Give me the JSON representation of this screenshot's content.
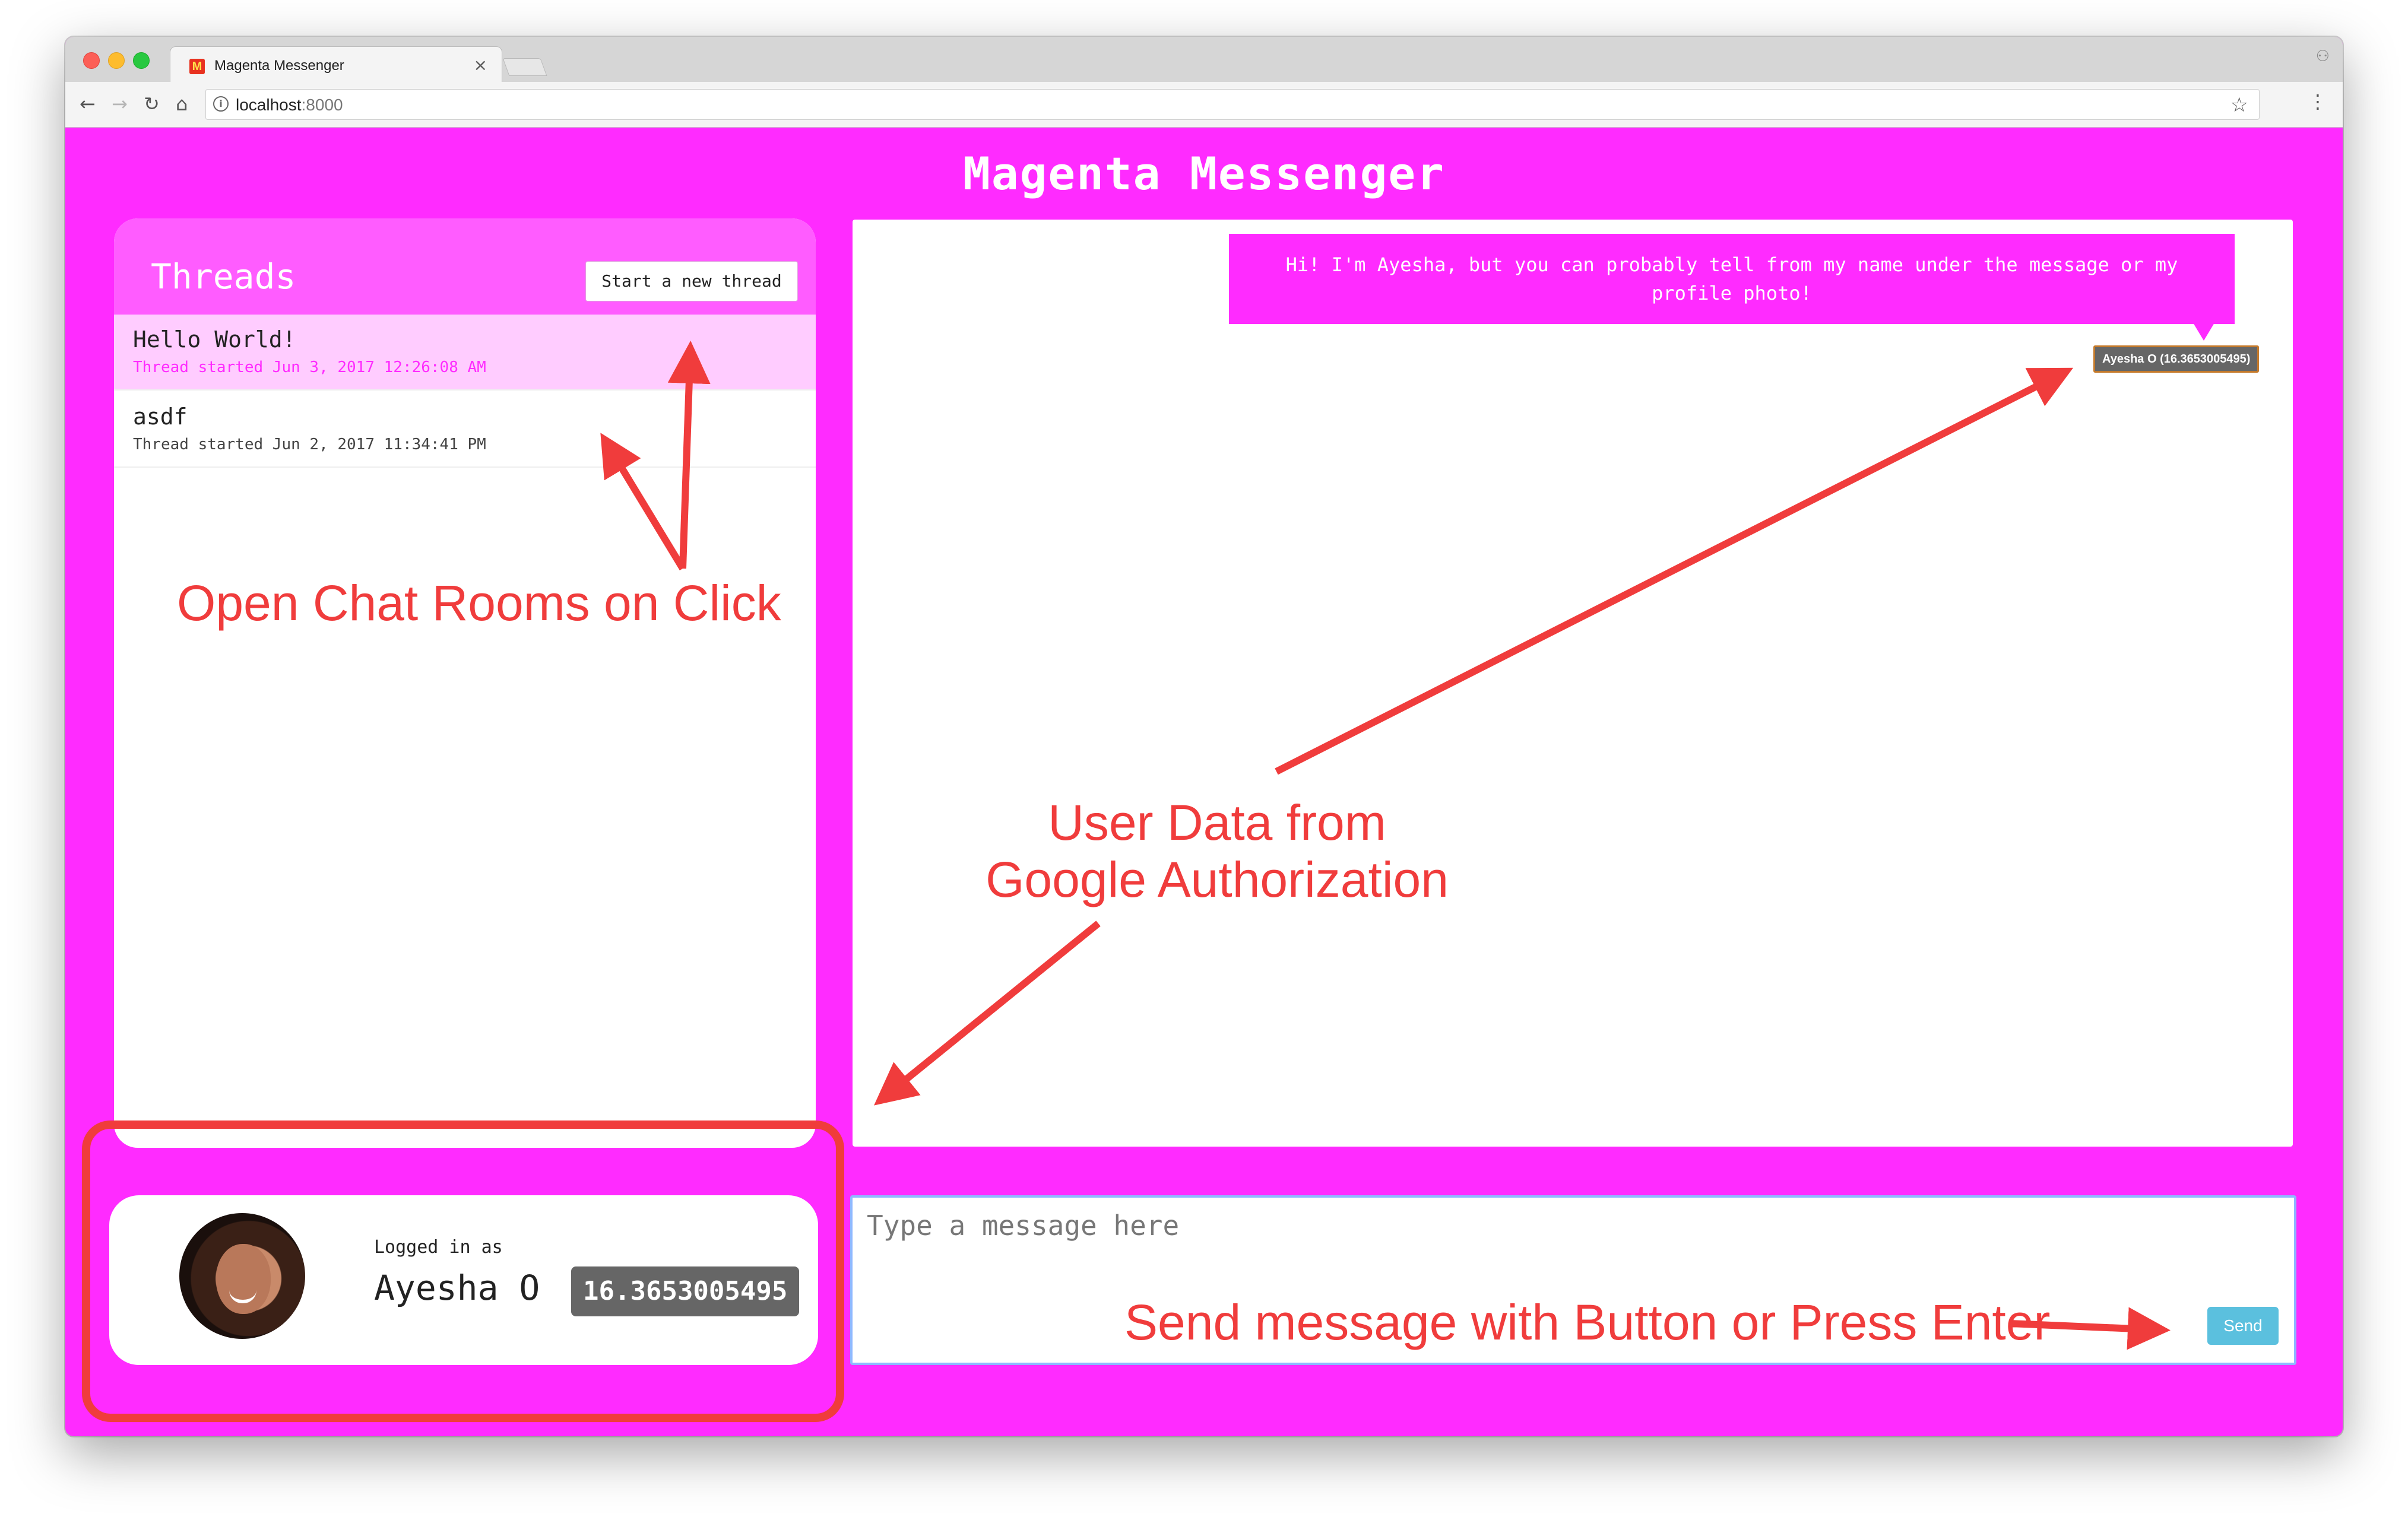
{
  "browser": {
    "tab_title": "Magenta Messenger",
    "tab_close": "×",
    "url_host": "localhost",
    "url_port": ":8000",
    "icons": {
      "back": "arrow-left",
      "forward": "arrow-right",
      "reload": "reload",
      "home": "home",
      "info": "info-circle",
      "bookmark": "star-outline",
      "menu": "kebab-vertical"
    }
  },
  "app": {
    "title": "Magenta Messenger",
    "accent_color": "#ff2bff",
    "threads": {
      "title": "Threads",
      "new_thread_button": "Start a new thread",
      "items": [
        {
          "name": "Hello World!",
          "started": "Thread started Jun 3, 2017 12:26:08 AM",
          "selected": true
        },
        {
          "name": "asdf",
          "started": "Thread started Jun 2, 2017 11:34:41 PM",
          "selected": false
        }
      ]
    },
    "messages": [
      {
        "text": "Hi! I'm Ayesha, but you can probably tell from my name under the message or my profile photo!",
        "sender": "Ayesha O (16.3653005495)"
      }
    ],
    "profile": {
      "logged_in_label": "Logged in as",
      "name": "Ayesha O",
      "id": "16.3653005495"
    },
    "composer": {
      "placeholder": "Type a message here",
      "value": "",
      "send_label": "Send",
      "send_color": "#5bc0de"
    }
  },
  "annotations": {
    "open_chat_rooms": "Open Chat Rooms on Click",
    "user_data_line1": "User Data from",
    "user_data_line2": "Google Authorization",
    "send_message": "Send message with Button or Press Enter",
    "color": "#f03c3c"
  }
}
